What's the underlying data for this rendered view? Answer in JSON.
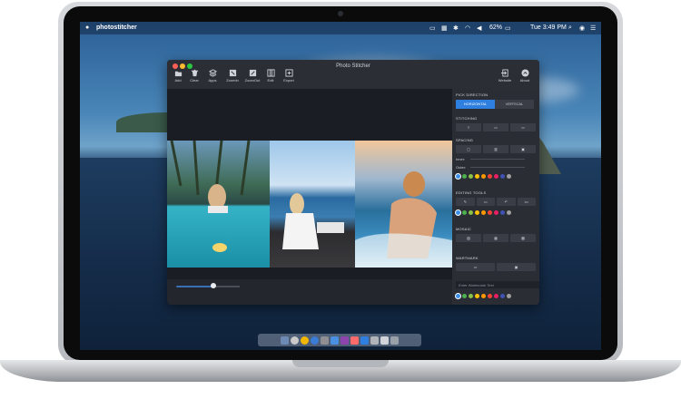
{
  "menubar": {
    "app_name": "photostitcher",
    "battery": "62%",
    "time": "Tue 3:49 PM"
  },
  "window": {
    "title": "Photo Stitcher",
    "toolbar": [
      {
        "label": "Add",
        "icon": "folder-icon"
      },
      {
        "label": "Clear",
        "icon": "trash-icon"
      },
      {
        "label": "Apps",
        "icon": "layers-icon"
      },
      {
        "label": "ZoomIn",
        "icon": "zoom-in-icon"
      },
      {
        "label": "ZoomOut",
        "icon": "zoom-out-icon"
      },
      {
        "label": "Edit",
        "icon": "edit-icon"
      },
      {
        "label": "Export",
        "icon": "export-icon"
      }
    ],
    "right_toolbar": [
      {
        "label": "Website",
        "icon": "website-icon"
      },
      {
        "label": "About",
        "icon": "about-icon"
      }
    ]
  },
  "panel": {
    "pick_direction": "PICK DIRECTION",
    "horizontal": "HORIZONTAL",
    "vertical": "VERTICAL",
    "stitching": "STITCHING",
    "spacing": "SPACING",
    "inner": "Inner:",
    "outer": "Outer:",
    "editing_tools": "EDITING TOOLS",
    "mosaic": "MOSAIC",
    "watermark": "WARTMARK",
    "watermark_placeholder": "Enter Watermark Text",
    "editing_more": "•••"
  },
  "colors": {
    "accent": "#2f7fe0",
    "swatches": [
      "#3b8fe6",
      "#4caf50",
      "#8bc34a",
      "#ffc107",
      "#ff9800",
      "#f44336",
      "#e91e63",
      "#3f51b5",
      "#9e9e9e"
    ]
  }
}
